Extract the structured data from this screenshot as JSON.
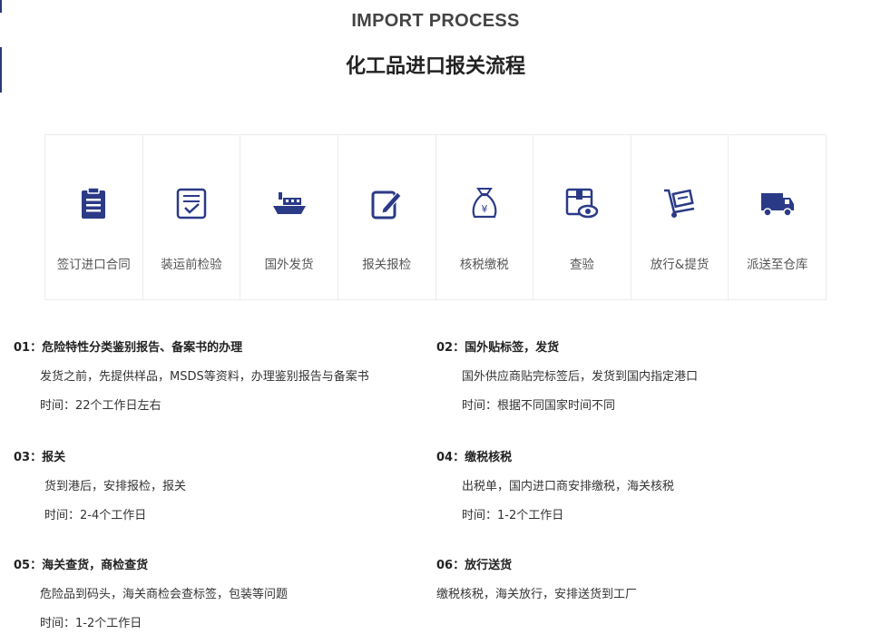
{
  "header": {
    "eyebrow": "IMPORT PROCESS",
    "title": "化工品进口报关流程"
  },
  "accent_color": "#2b3a87",
  "steps": [
    {
      "label": "签订进口合同",
      "icon": "clipboard-icon"
    },
    {
      "label": "装运前检验",
      "icon": "checklist-icon"
    },
    {
      "label": "国外发货",
      "icon": "ship-icon"
    },
    {
      "label": "报关报检",
      "icon": "edit-form-icon"
    },
    {
      "label": "核税缴税",
      "icon": "money-bag-icon"
    },
    {
      "label": "查验",
      "icon": "box-inspect-icon"
    },
    {
      "label": "放行&提货",
      "icon": "hand-truck-icon"
    },
    {
      "label": "派送至仓库",
      "icon": "delivery-truck-icon"
    }
  ],
  "details": [
    {
      "head": "01：危险特性分类鉴别报告、备案书的办理",
      "line1": "发货之前，先提供样品，MSDS等资料，办理鉴别报告与备案书",
      "line2": "时间：22个工作日左右"
    },
    {
      "head": "02：国外贴标签，发货",
      "line1": "国外供应商贴完标签后，发货到国内指定港口",
      "line2": "时间：根据不同国家时间不同"
    },
    {
      "head": "03：报关",
      "line1": "货到港后，安排报检，报关",
      "line2": "时间：2-4个工作日"
    },
    {
      "head": "04：缴税核税",
      "line1": "出税单，国内进口商安排缴税，海关核税",
      "line2": "时间：1-2个工作日"
    },
    {
      "head": "05：海关查货，商检查货",
      "line1": "危险品到码头，海关商检会查标签，包装等问题",
      "line2": "时间：1-2个工作日"
    },
    {
      "head": "06：放行送货",
      "line1": "缴税核税，海关放行，安排送货到工厂"
    }
  ]
}
